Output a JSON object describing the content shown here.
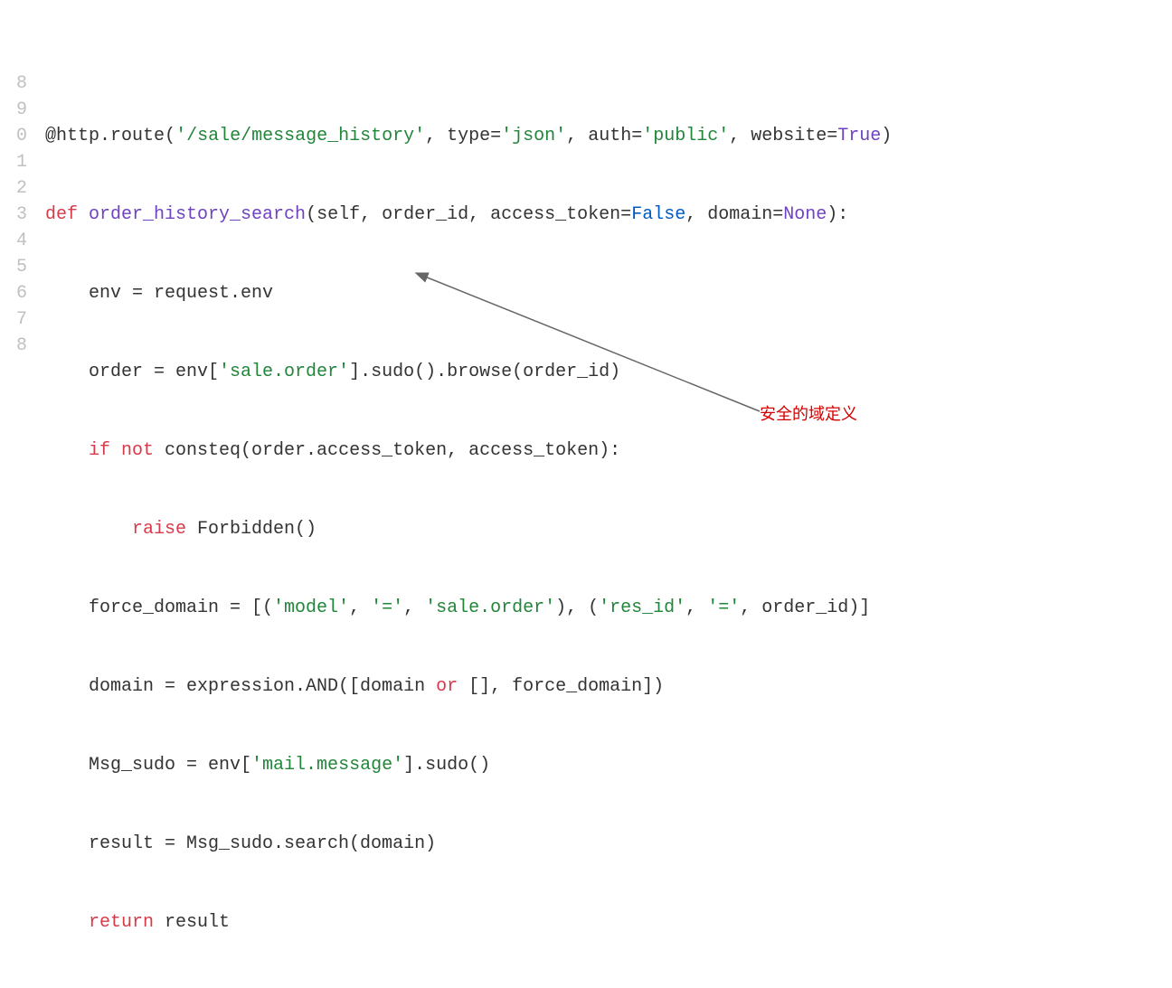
{
  "line_numbers": [
    "8",
    "9",
    "0",
    "1",
    "2",
    "3",
    "4",
    "5",
    "6",
    "7",
    "8"
  ],
  "code": {
    "l0_dec": "@http",
    "l0_dot": ".",
    "l0_route": "route",
    "l0_open": "(",
    "l0_url": "'/sale/message_history'",
    "l0_c1": ", ",
    "l0_type_k": "type",
    "l0_eq1": "=",
    "l0_type_v": "'json'",
    "l0_c2": ", ",
    "l0_auth_k": "auth",
    "l0_eq2": "=",
    "l0_auth_v": "'public'",
    "l0_c3": ", ",
    "l0_web_k": "website",
    "l0_eq3": "=",
    "l0_web_v": "True",
    "l0_close": ")",
    "l1_def": "def ",
    "l1_name": "order_history_search",
    "l1_open": "(",
    "l1_self": "self",
    "l1_c1": ", ",
    "l1_oid": "order_id",
    "l1_c2": ", ",
    "l1_at": "access_token",
    "l1_eq1": "=",
    "l1_false": "False",
    "l1_c3": ", ",
    "l1_dom": "domain",
    "l1_eq2": "=",
    "l1_none": "None",
    "l1_close": "):",
    "l2": "    env = request.env",
    "l3_a": "    order = env[",
    "l3_s": "'sale.order'",
    "l3_b": "].sudo().browse(order_id)",
    "l4_if": "    if ",
    "l4_not": "not ",
    "l4_rest": "consteq(order.access_token, access_token):",
    "l5_raise": "        raise ",
    "l5_rest": "Forbidden()",
    "l6_a": "    force_domain = [(",
    "l6_s1": "'model'",
    "l6_c1": ", ",
    "l6_s2": "'='",
    "l6_c2": ", ",
    "l6_s3": "'sale.order'",
    "l6_c3": "), (",
    "l6_s4": "'res_id'",
    "l6_c4": ", ",
    "l6_s5": "'='",
    "l6_c5": ", order_id)]",
    "l7_a": "    domain = expression.AND([domain ",
    "l7_or": "or",
    "l7_b": " [], force_domain])",
    "l8_a": "    Msg_sudo = env[",
    "l8_s": "'mail.message'",
    "l8_b": "].sudo()",
    "l9": "    result = Msg_sudo.search(domain)",
    "l10_ret": "    return ",
    "l10_rest": "result"
  },
  "annotation": "安全的域定义"
}
